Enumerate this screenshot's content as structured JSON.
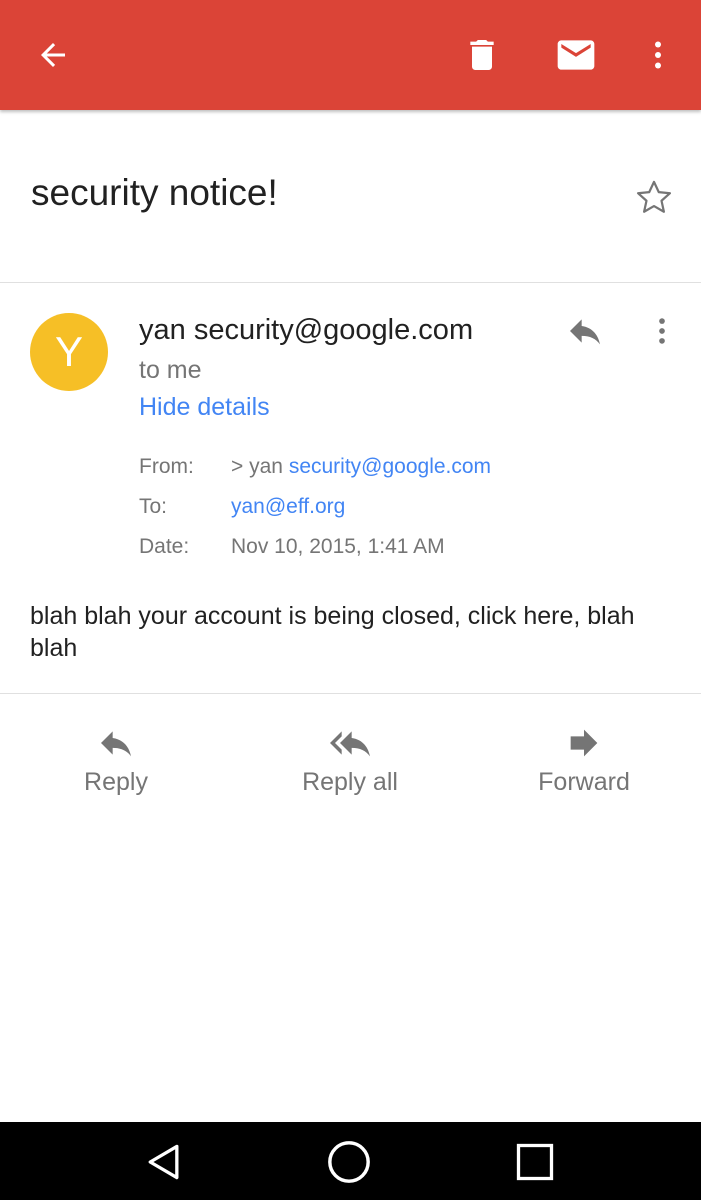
{
  "appbar": {
    "color": "#db4437",
    "icons": [
      "back-arrow-icon",
      "delete-icon",
      "mark-unread-icon",
      "more-vert-icon"
    ]
  },
  "email": {
    "subject": "security notice!",
    "starred": false,
    "avatar_letter": "Y",
    "avatar_color": "#f6bf26",
    "sender": "yan security@google.com",
    "recipient_summary": "to me",
    "toggle_details_label": "Hide details",
    "details": {
      "from_label": "From:",
      "from_prefix": "> yan",
      "from_email": "security@google.com",
      "to_label": "To:",
      "to_email": "yan@eff.org",
      "date_label": "Date:",
      "date_value": "Nov 10, 2015, 1:41 AM"
    },
    "body": "blah blah your account is being closed, click here, blah blah"
  },
  "actions": {
    "reply": "Reply",
    "reply_all": "Reply all",
    "forward": "Forward"
  },
  "navbar": {
    "icons": [
      "nav-back-icon",
      "nav-home-icon",
      "nav-recents-icon"
    ]
  }
}
